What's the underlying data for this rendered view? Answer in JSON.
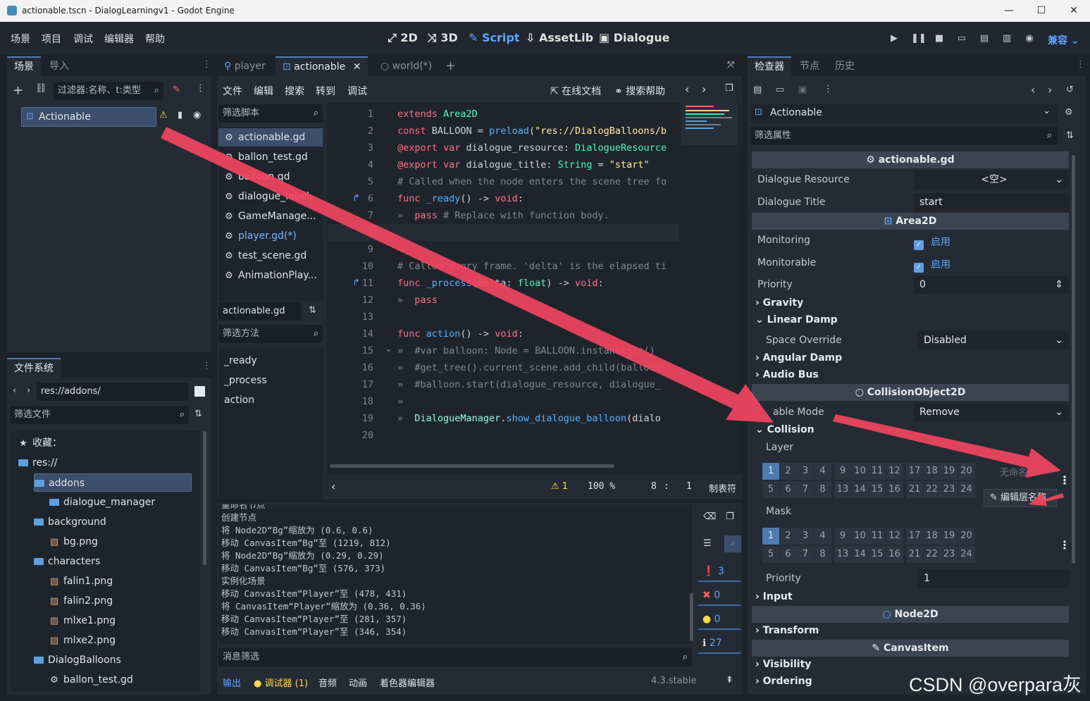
{
  "window": {
    "title": "actionable.tscn - DialogLearningv1 - Godot Engine",
    "min": "—",
    "max": "☐",
    "close": "✕"
  },
  "menu": [
    "场景",
    "项目",
    "调试",
    "编辑器",
    "帮助"
  ],
  "main_screens": [
    {
      "icon": "⤢",
      "label": "2D"
    },
    {
      "icon": "⤨",
      "label": "3D"
    },
    {
      "icon": "✎",
      "label": "Script"
    },
    {
      "icon": "⇩",
      "label": "AssetLib"
    },
    {
      "icon": "▣",
      "label": "Dialogue"
    }
  ],
  "renderer": "兼容",
  "scene_dock": {
    "tabs": [
      "场景",
      "导入"
    ],
    "filter_placeholder": "过滤器:名称、t:类型",
    "node": "Actionable"
  },
  "filesystem": {
    "tab": "文件系统",
    "path": "res://addons/",
    "filter_placeholder": "筛选文件",
    "items": [
      {
        "label": "收藏：",
        "kind": "star",
        "depth": 0
      },
      {
        "label": "res://",
        "kind": "folder",
        "depth": 0
      },
      {
        "label": "addons",
        "kind": "folder",
        "depth": 1,
        "selected": true
      },
      {
        "label": "dialogue_manager",
        "kind": "folder",
        "depth": 2
      },
      {
        "label": "background",
        "kind": "folder",
        "depth": 1
      },
      {
        "label": "bg.png",
        "kind": "image",
        "depth": 2
      },
      {
        "label": "characters",
        "kind": "folder",
        "depth": 1
      },
      {
        "label": "falin1.png",
        "kind": "image",
        "depth": 2
      },
      {
        "label": "falin2.png",
        "kind": "image",
        "depth": 2
      },
      {
        "label": "mlxe1.png",
        "kind": "image",
        "depth": 2
      },
      {
        "label": "mlxe2.png",
        "kind": "image",
        "depth": 2
      },
      {
        "label": "DialogBalloons",
        "kind": "folder",
        "depth": 1
      },
      {
        "label": "ballon_test.gd",
        "kind": "script",
        "depth": 2
      }
    ]
  },
  "editor_tabs": [
    {
      "label": "player",
      "active": false
    },
    {
      "label": "actionable",
      "active": true
    },
    {
      "label": "world(*)",
      "active": false
    }
  ],
  "script_menu": [
    "文件",
    "编辑",
    "搜索",
    "转到",
    "调试"
  ],
  "script_links": [
    "在线文档",
    "搜索帮助"
  ],
  "script_filter_placeholder": "筛选脚本",
  "scripts": [
    "actionable.gd",
    "ballon_test.gd",
    "balloon.gd",
    "dialogue_label...",
    "GameManage...",
    "player.gd(*)",
    "test_scene.gd",
    "AnimationPlay..."
  ],
  "current_script": "actionable.gd",
  "method_filter_placeholder": "筛选方法",
  "methods": [
    "_ready",
    "_process",
    "action"
  ],
  "code": [
    [
      [
        "kw",
        "extends "
      ],
      [
        "ty",
        "Area2D"
      ]
    ],
    [
      [
        "kw",
        "const "
      ],
      [
        "tx",
        "BALLOON = "
      ],
      [
        "fn",
        "preload"
      ],
      [
        "tx",
        "("
      ],
      [
        "st",
        "\"res://DialogBalloons/b"
      ]
    ],
    [
      [
        "kw",
        "@export var "
      ],
      [
        "tx",
        "dialogue_resource: "
      ],
      [
        "ty",
        "DialogueResource"
      ]
    ],
    [
      [
        "kw",
        "@export var "
      ],
      [
        "tx",
        "dialogue_title: "
      ],
      [
        "ty",
        "String"
      ],
      [
        "tx",
        " = "
      ],
      [
        "st",
        "\"start\""
      ]
    ],
    [
      [
        "cm",
        "# Called when the node enters the scene tree fo"
      ]
    ],
    [
      [
        "kw",
        "func "
      ],
      [
        "fn",
        "_ready"
      ],
      [
        "tx",
        "() -> "
      ],
      [
        "kw",
        "void"
      ],
      [
        "tx",
        ":"
      ]
    ],
    [
      [
        "cm",
        "»  "
      ],
      [
        "kw",
        "pass "
      ],
      [
        "cm",
        "# Replace with function body."
      ]
    ],
    [],
    [],
    [
      [
        "cm",
        "# Called every frame. 'delta' is the elapsed ti"
      ]
    ],
    [
      [
        "kw",
        "func "
      ],
      [
        "fn",
        "_process"
      ],
      [
        "tx",
        "(delta: "
      ],
      [
        "ty",
        "float"
      ],
      [
        "tx",
        ") -> "
      ],
      [
        "kw",
        "void"
      ],
      [
        "tx",
        ":"
      ]
    ],
    [
      [
        "cm",
        "»  "
      ],
      [
        "kw",
        "pass"
      ]
    ],
    [],
    [
      [
        "kw",
        "func "
      ],
      [
        "fn",
        "action"
      ],
      [
        "tx",
        "() -> "
      ],
      [
        "kw",
        "void"
      ],
      [
        "tx",
        ":"
      ]
    ],
    [
      [
        "cm",
        "»  #var balloon: Node = BALLOON.instantiate()"
      ]
    ],
    [
      [
        "cm",
        "»  #get_tree().current_scene.add_child(balloon)"
      ]
    ],
    [
      [
        "cm",
        "»  #balloon.start(dialogue_resource, dialogue_"
      ]
    ],
    [
      [
        "cm",
        "»"
      ]
    ],
    [
      [
        "cm",
        "»  "
      ],
      [
        "cl",
        "DialogueManager"
      ],
      [
        "tx",
        "."
      ],
      [
        "fn",
        "show_dialogue_balloon"
      ],
      [
        "tx",
        "(dialo"
      ]
    ],
    []
  ],
  "code_status": {
    "warnings": "1",
    "zoom": "100 %",
    "line": "8",
    "sep": ":",
    "col": "1",
    "indent": "制表符"
  },
  "output": {
    "lines": [
      "重命名节点",
      "创建节点",
      "将 Node2D“Bg”缩放为 (0.6, 0.6)",
      "移动 CanvasItem“Bg”至 (1219, 812)",
      "将 Node2D“Bg”缩放为 (0.29, 0.29)",
      "移动 CanvasItem“Bg”至 (576, 373)",
      "实例化场景",
      "移动 CanvasItem“Player”至 (478, 431)",
      "将 CanvasItem“Player”缩放为 (0.36, 0.36)",
      "移动 CanvasItem“Player”至 (281, 357)",
      "移动 CanvasItem“Player”至 (346, 354)"
    ],
    "filter_placeholder": "消息筛选",
    "counts": {
      "messages": "3",
      "errors": "0",
      "warnings": "0",
      "other": "27"
    }
  },
  "bottom_tabs": [
    "输出",
    "调试器 (1)",
    "音频",
    "动画",
    "着色器编辑器"
  ],
  "version": "4.3.stable",
  "inspector": {
    "tabs": [
      "检查器",
      "节点",
      "历史"
    ],
    "node": "Actionable",
    "filter_placeholder": "筛选属性",
    "script_section": "actionable.gd",
    "dialogue_resource": {
      "label": "Dialogue Resource",
      "value": "<空>"
    },
    "dialogue_title": {
      "label": "Dialogue Title",
      "value": "start"
    },
    "area_section": "Area2D",
    "monitoring": {
      "label": "Monitoring",
      "value": "启用"
    },
    "monitorable": {
      "label": "Monitorable",
      "value": "启用"
    },
    "priority": {
      "label": "Priority",
      "value": "0"
    },
    "groups": [
      "Gravity",
      "Linear Damp",
      "Angular Damp",
      "Audio Bus"
    ],
    "space_override": {
      "label": "Space Override",
      "value": "Disabled"
    },
    "collision_section": "CollisionObject2D",
    "disable_mode": {
      "label": "able Mode",
      "value": "Remove"
    },
    "collision_group": "Collision",
    "layer_label": "Layer",
    "mask_label": "Mask",
    "layer_top": [
      "1",
      "2",
      "3",
      "4",
      "9",
      "10",
      "11",
      "12",
      "17",
      "18",
      "19",
      "20"
    ],
    "layer_bottom": [
      "5",
      "6",
      "7",
      "8",
      "13",
      "14",
      "15",
      "16",
      "21",
      "22",
      "23",
      "24"
    ],
    "layer_name": "无命名",
    "edit_layer": "编辑层名称",
    "collision_priority": {
      "label": "Priority",
      "value": "1"
    },
    "input_group": "Input",
    "node2d_section": "Node2D",
    "transform_group": "Transform",
    "canvas_section": "CanvasItem",
    "visibility_group": "Visibility",
    "ordering_group": "Ordering"
  },
  "watermark": "CSDN @overpara灰",
  "colors": {
    "accent": "#5e9fe0",
    "annotation_arrow": "#f2455f"
  }
}
